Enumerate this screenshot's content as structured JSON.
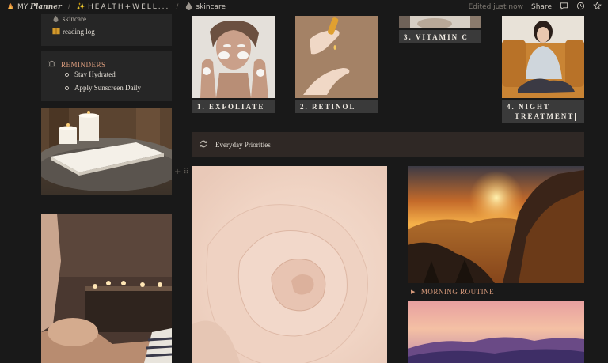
{
  "breadcrumb": {
    "planner_prefix": "MY",
    "planner_name": "Planner",
    "health": "HEALTH+WELL...",
    "current": "skincare"
  },
  "topbar": {
    "edited": "Edited just now",
    "share": "Share"
  },
  "sidebar": {
    "items": [
      {
        "label": "skincare"
      },
      {
        "label": "reading log"
      }
    ],
    "reminders": {
      "title": "REMINDERS",
      "items": [
        "Stay Hydrated",
        "Apply Sunscreen Daily"
      ]
    }
  },
  "steps": [
    {
      "label": "1. EXFOLIATE"
    },
    {
      "label": "2. RETINOL"
    },
    {
      "label": "3. VITAMIN C"
    },
    {
      "label_line1": "4. NIGHT",
      "label_line2": "TREATMENT"
    }
  ],
  "priorities": {
    "label": "Everyday Priorities"
  },
  "routine": {
    "label": "MORNING ROUTINE"
  }
}
